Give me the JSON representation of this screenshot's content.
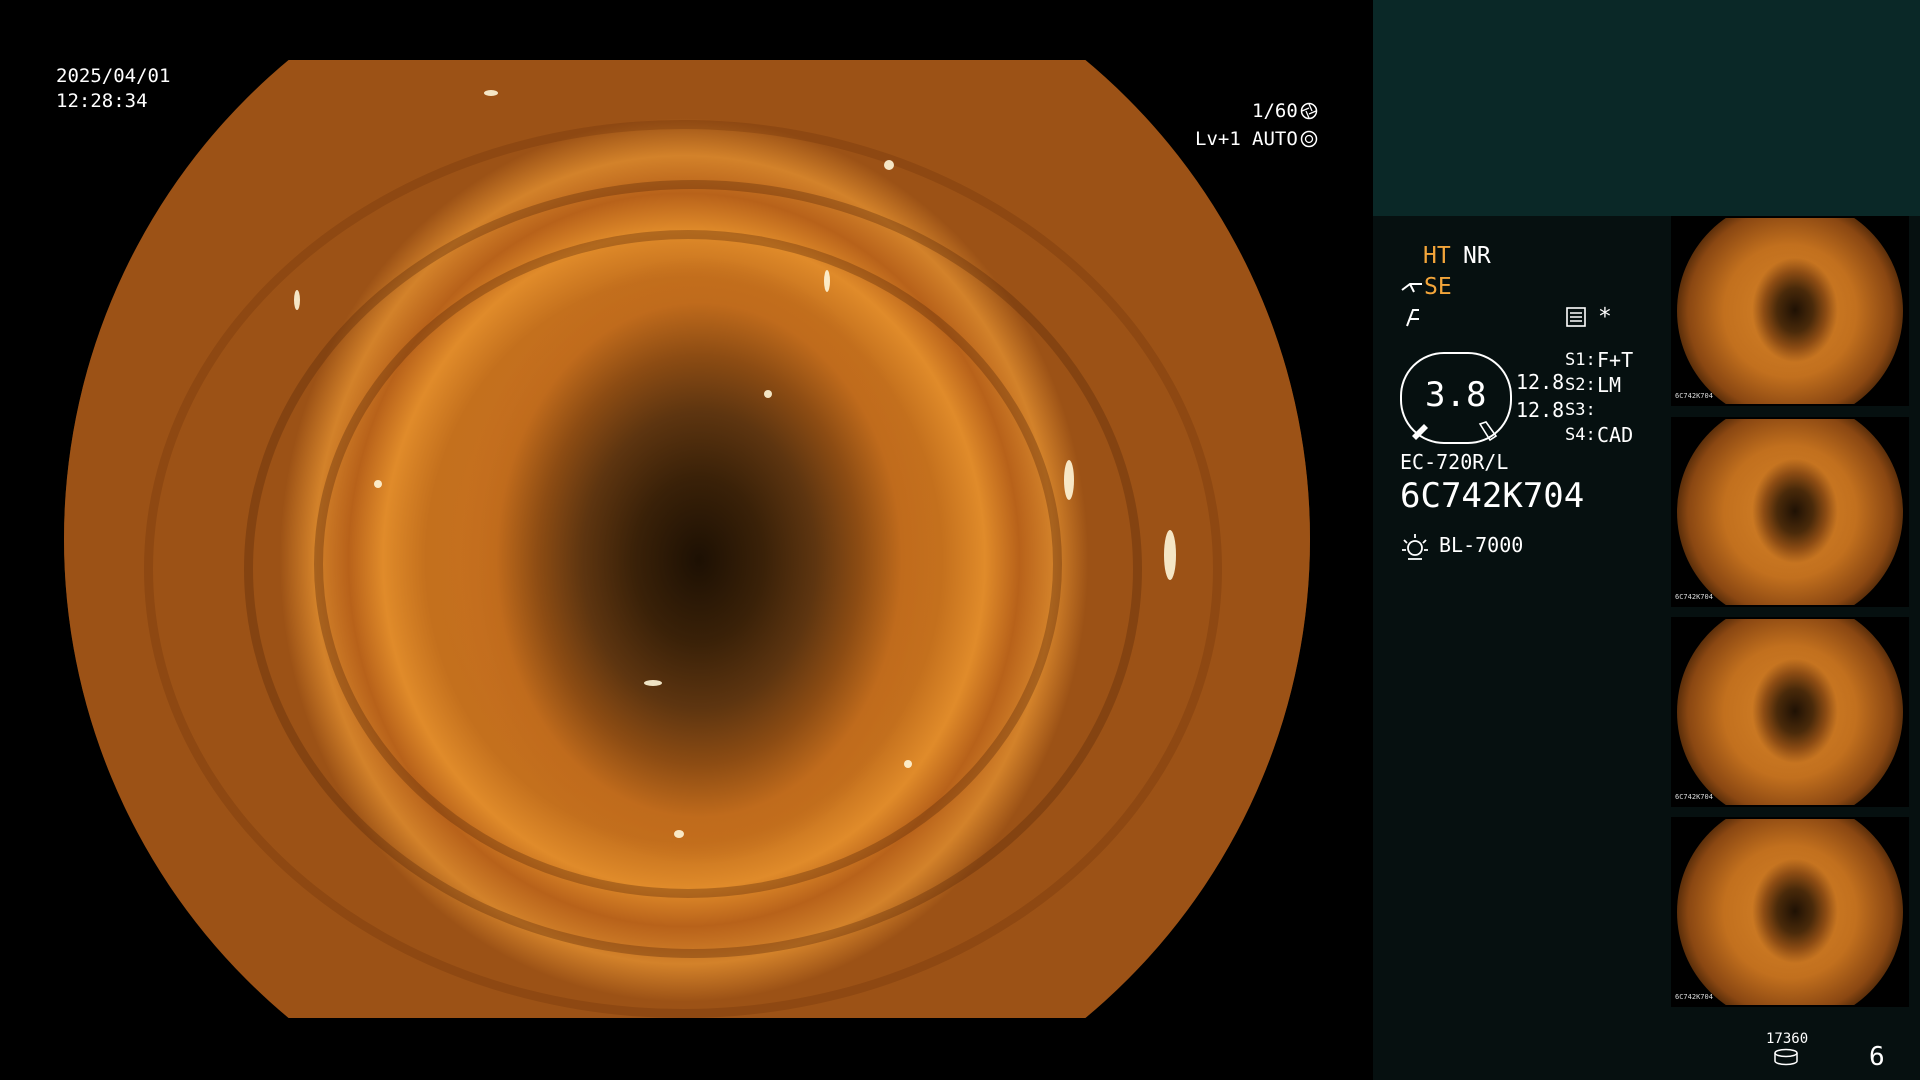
{
  "overlay": {
    "date": "2025/04/01",
    "time": "12:28:34",
    "shutter": "1/60",
    "level": "Lv+1",
    "iris": "AUTO"
  },
  "panel": {
    "ht": "HT",
    "nr": "NR",
    "se": "SE",
    "gauge_value": "3.8",
    "value_a": "12.8",
    "value_b": "12.8",
    "s1_label": "S1:",
    "s1_value": "F+T",
    "s2_label": "S2:",
    "s2_value": "LM",
    "s3_label": "S3:",
    "s3_value": "",
    "s4_label": "S4:",
    "s4_value": "CAD",
    "scope_model": "EC-720R/L",
    "scope_serial": "6C742K704",
    "light_source": "BL-7000",
    "storage_count": "17360",
    "image_count": "6"
  },
  "thumbnails": [
    {
      "label": "6C742K704"
    },
    {
      "label": "6C742K704"
    },
    {
      "label": "6C742K704"
    },
    {
      "label": "6C742K704"
    }
  ],
  "colors": {
    "accent_orange": "#f3a53a",
    "panel_bg": "#061010",
    "panel_top_bg": "#0a2827"
  },
  "icons": [
    "shutter-icon",
    "iris-icon",
    "scissors-icon",
    "settings-icon",
    "asterisk-icon",
    "lamp-icon",
    "storage-icon"
  ]
}
